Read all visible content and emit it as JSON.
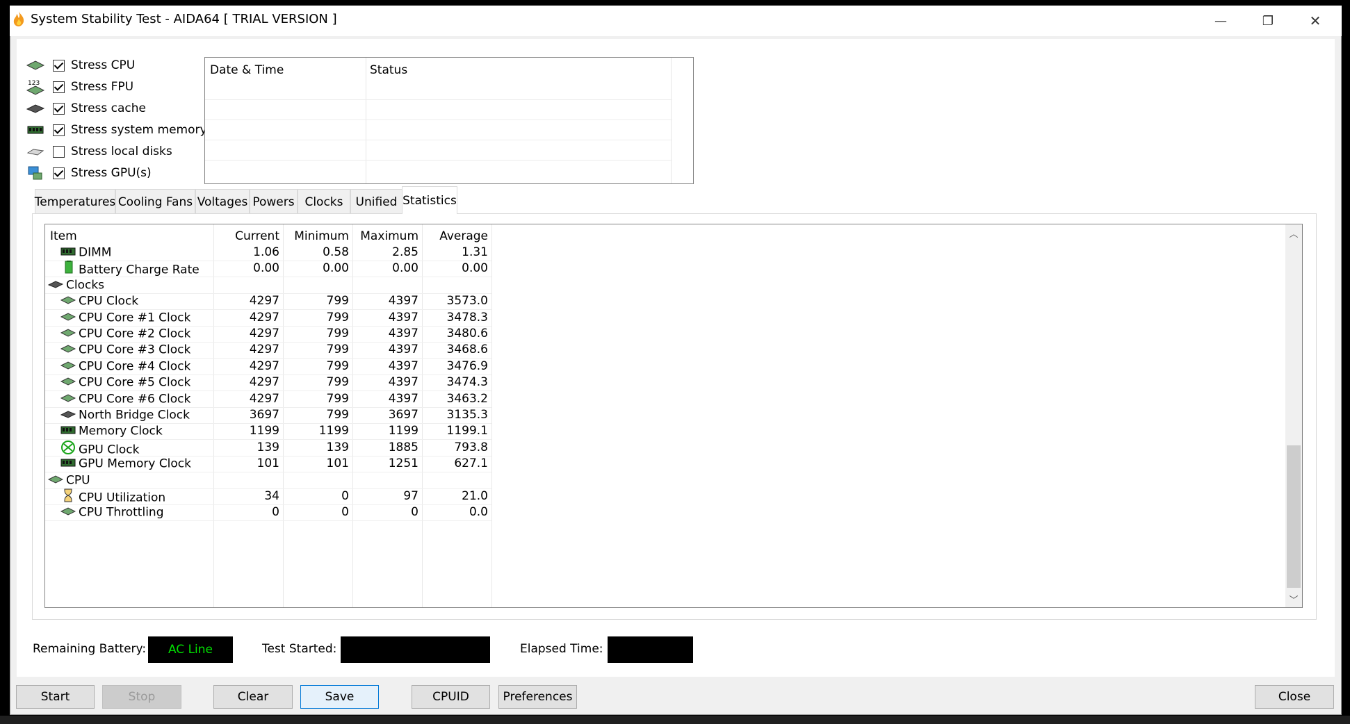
{
  "window": {
    "title": "System Stability Test - AIDA64  [ TRIAL VERSION ]"
  },
  "controls": {
    "minimize": "—",
    "maximize": "❐",
    "close": "✕"
  },
  "stress_options": [
    {
      "label": "Stress CPU",
      "checked": true,
      "icon": "cpu-icon"
    },
    {
      "label": "Stress FPU",
      "checked": true,
      "icon": "fpu-icon"
    },
    {
      "label": "Stress cache",
      "checked": true,
      "icon": "cache-icon"
    },
    {
      "label": "Stress system memory",
      "checked": true,
      "icon": "memory-icon"
    },
    {
      "label": "Stress local disks",
      "checked": false,
      "icon": "disk-icon"
    },
    {
      "label": "Stress GPU(s)",
      "checked": true,
      "icon": "gpu-icon"
    }
  ],
  "fpu_icon_text": "123",
  "log": {
    "col_datetime": "Date & Time",
    "col_status": "Status"
  },
  "tabs": [
    "Temperatures",
    "Cooling Fans",
    "Voltages",
    "Powers",
    "Clocks",
    "Unified",
    "Statistics"
  ],
  "active_tab": "Statistics",
  "stats": {
    "headers": {
      "item": "Item",
      "current": "Current",
      "minimum": "Minimum",
      "maximum": "Maximum",
      "average": "Average"
    },
    "rows": [
      {
        "indent": 1,
        "icon": "dimm",
        "item": "DIMM",
        "current": "1.06",
        "minimum": "0.58",
        "maximum": "2.85",
        "average": "1.31"
      },
      {
        "indent": 1,
        "icon": "battery",
        "item": "Battery Charge Rate",
        "current": "0.00",
        "minimum": "0.00",
        "maximum": "0.00",
        "average": "0.00"
      },
      {
        "indent": 0,
        "icon": "chip",
        "item": "Clocks",
        "current": "",
        "minimum": "",
        "maximum": "",
        "average": ""
      },
      {
        "indent": 1,
        "icon": "cpu",
        "item": "CPU Clock",
        "current": "4297",
        "minimum": "799",
        "maximum": "4397",
        "average": "3573.0"
      },
      {
        "indent": 1,
        "icon": "cpu",
        "item": "CPU Core #1 Clock",
        "current": "4297",
        "minimum": "799",
        "maximum": "4397",
        "average": "3478.3"
      },
      {
        "indent": 1,
        "icon": "cpu",
        "item": "CPU Core #2 Clock",
        "current": "4297",
        "minimum": "799",
        "maximum": "4397",
        "average": "3480.6"
      },
      {
        "indent": 1,
        "icon": "cpu",
        "item": "CPU Core #3 Clock",
        "current": "4297",
        "minimum": "799",
        "maximum": "4397",
        "average": "3468.6"
      },
      {
        "indent": 1,
        "icon": "cpu",
        "item": "CPU Core #4 Clock",
        "current": "4297",
        "minimum": "799",
        "maximum": "4397",
        "average": "3476.9"
      },
      {
        "indent": 1,
        "icon": "cpu",
        "item": "CPU Core #5 Clock",
        "current": "4297",
        "minimum": "799",
        "maximum": "4397",
        "average": "3474.3"
      },
      {
        "indent": 1,
        "icon": "cpu",
        "item": "CPU Core #6 Clock",
        "current": "4297",
        "minimum": "799",
        "maximum": "4397",
        "average": "3463.2"
      },
      {
        "indent": 1,
        "icon": "chip",
        "item": "North Bridge Clock",
        "current": "3697",
        "minimum": "799",
        "maximum": "3697",
        "average": "3135.3"
      },
      {
        "indent": 1,
        "icon": "dimm",
        "item": "Memory Clock",
        "current": "1199",
        "minimum": "1199",
        "maximum": "1199",
        "average": "1199.1"
      },
      {
        "indent": 1,
        "icon": "xbox",
        "item": "GPU Clock",
        "current": "139",
        "minimum": "139",
        "maximum": "1885",
        "average": "793.8"
      },
      {
        "indent": 1,
        "icon": "dimm",
        "item": "GPU Memory Clock",
        "current": "101",
        "minimum": "101",
        "maximum": "1251",
        "average": "627.1"
      },
      {
        "indent": 0,
        "icon": "cpu",
        "item": "CPU",
        "current": "",
        "minimum": "",
        "maximum": "",
        "average": ""
      },
      {
        "indent": 1,
        "icon": "hourglass",
        "item": "CPU Utilization",
        "current": "34",
        "minimum": "0",
        "maximum": "97",
        "average": "21.0"
      },
      {
        "indent": 1,
        "icon": "cpu",
        "item": "CPU Throttling",
        "current": "0",
        "minimum": "0",
        "maximum": "0",
        "average": "0.0"
      }
    ]
  },
  "status_bar": {
    "battery_label": "Remaining Battery:",
    "battery_value": "AC Line",
    "test_started_label": "Test Started:",
    "test_started_value": "",
    "elapsed_label": "Elapsed Time:",
    "elapsed_value": ""
  },
  "buttons": {
    "start": "Start",
    "stop": "Stop",
    "clear": "Clear",
    "save": "Save",
    "cpuid": "CPUID",
    "preferences": "Preferences",
    "close": "Close"
  },
  "colors": {
    "ac_line_text": "#00e000",
    "focus_border": "#0078d7",
    "flame": "#f39a1e"
  }
}
